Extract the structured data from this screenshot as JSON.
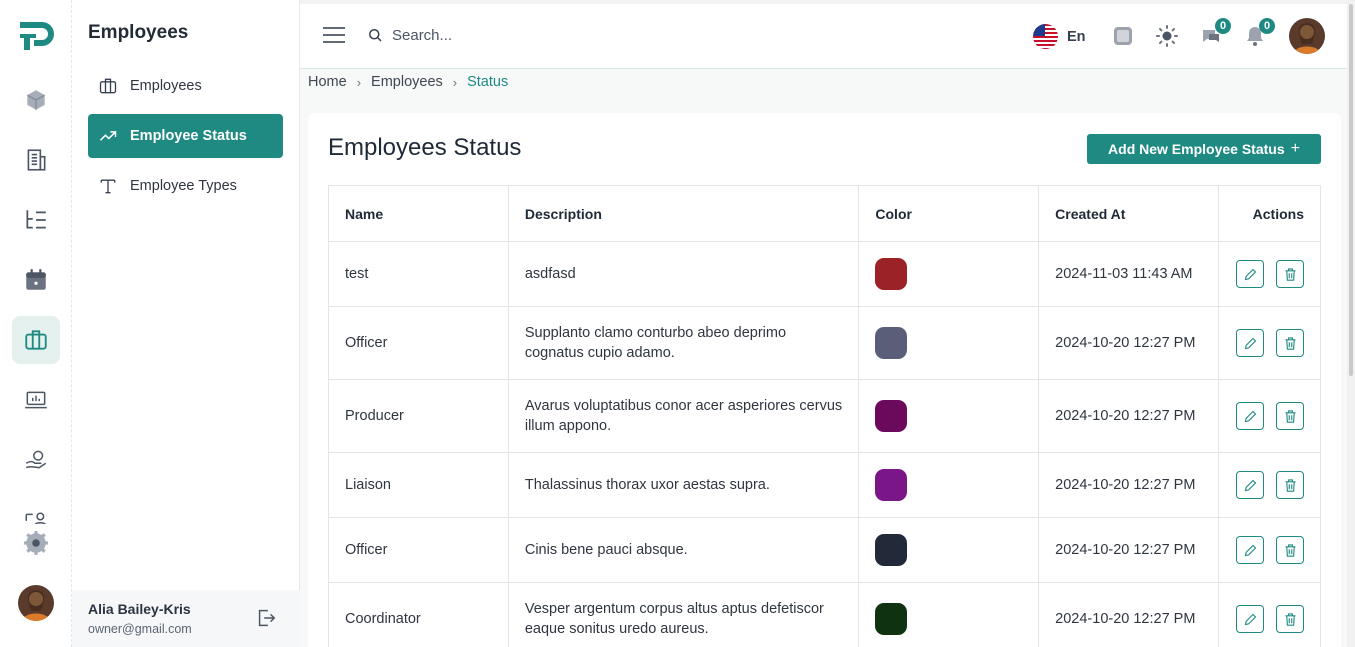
{
  "sidebar": {
    "title": "Employees",
    "items": [
      {
        "label": "Employees"
      },
      {
        "label": "Employee Status"
      },
      {
        "label": "Employee Types"
      }
    ],
    "user": {
      "name": "Alia Bailey-Kris",
      "email": "owner@gmail.com"
    }
  },
  "topbar": {
    "search_placeholder": "Search...",
    "language": "En",
    "messages_count": "0",
    "notifications_count": "0"
  },
  "breadcrumb": {
    "home": "Home",
    "section": "Employees",
    "current": "Status"
  },
  "page": {
    "title": "Employees Status",
    "add_button": "Add New Employee Status",
    "add_button_icon": "+"
  },
  "table": {
    "headers": {
      "name": "Name",
      "description": "Description",
      "color": "Color",
      "created": "Created At",
      "actions": "Actions"
    },
    "rows": [
      {
        "name": "test",
        "description": "asdfasd",
        "color": "#9b2226",
        "created": "2024-11-03 11:43 AM"
      },
      {
        "name": "Officer",
        "description": "Supplanto clamo conturbo abeo deprimo cognatus cupio adamo.",
        "color": "#5a5e78",
        "created": "2024-10-20 12:27 PM"
      },
      {
        "name": "Producer",
        "description": "Avarus voluptatibus conor acer asperiores cervus illum appono.",
        "color": "#6b0a5b",
        "created": "2024-10-20 12:27 PM"
      },
      {
        "name": "Liaison",
        "description": "Thalassinus thorax uxor aestas supra.",
        "color": "#7a1687",
        "created": "2024-10-20 12:27 PM"
      },
      {
        "name": "Officer",
        "description": "Cinis bene pauci absque.",
        "color": "#222938",
        "created": "2024-10-20 12:27 PM"
      },
      {
        "name": "Coordinator",
        "description": "Vesper argentum corpus altus aptus defetiscor eaque sonitus uredo aureus.",
        "color": "#0f3210",
        "created": "2024-10-20 12:27 PM"
      }
    ]
  },
  "colors": {
    "accent": "#1f8a82"
  }
}
